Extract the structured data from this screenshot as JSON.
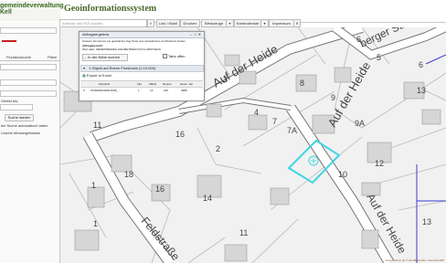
{
  "header": {
    "brand_line1": "gemeindeverwaltung",
    "brand_line2": "Kell",
    "app_title": "Geoinformationssystem"
  },
  "toolbar": {
    "search_placeholder": "Adresse und POI suchen",
    "link_label": "Link / Mobil",
    "print_label": "Drucken",
    "tools_label": "Werkzeuge",
    "map_services_label": "Kartendienste",
    "imprint_label": "Impressum"
  },
  "sidebar": {
    "tab_label": "Flurstücksuche",
    "tab2_label": "Pläne",
    "field_label": "Gebiet bis:",
    "search_button": "Suche starten",
    "option1": "bei Suche automatisch laden",
    "option2": "Lösche Messergebnisse"
  },
  "popup": {
    "title": "Abfrageergebnis",
    "info_line": "Hinweis: Es können ein geändertes Sog Texte eine Auswahl des am Rückend stehen",
    "query_label": "Abfragebereich:",
    "query_text": "Wert aktiv: GEMEINDEWEG-GEOMETRIE/FLST-FLURSTUECK",
    "nearby_button": "In der Nähe suchen",
    "transparent_label": "Tabs offen",
    "group_label": "1 Objekt auf Ebene Flurstücke (1:10.000)",
    "export_button": "Export to Excel",
    "columns": [
      "Flurstück",
      "Flur",
      "Zähler",
      "Nenner",
      "Geom. Ha"
    ],
    "rows": [
      [
        "07260000100014028_...",
        "1",
        "14",
        "226",
        "2989"
      ]
    ]
  },
  "map": {
    "streets": [
      "Auf der Heide",
      "Auf der Heide",
      "Feldstraße",
      "berger Straße"
    ],
    "house_numbers": [
      "11",
      "18",
      "1",
      "16",
      "14",
      "7",
      "7A",
      "8",
      "9",
      "9A",
      "10",
      "12",
      "13",
      "5",
      "3",
      "2",
      "4",
      "6",
      "1",
      "11",
      "16",
      "13",
      "6"
    ],
    "attribution": "Geoportal.rlp.de © GeoBasis-DE / LVermGeoRP"
  },
  "colors": {
    "selection": "#3fd6e3",
    "boundary": "#3b3bd6",
    "brand": "#3a6b1f"
  }
}
